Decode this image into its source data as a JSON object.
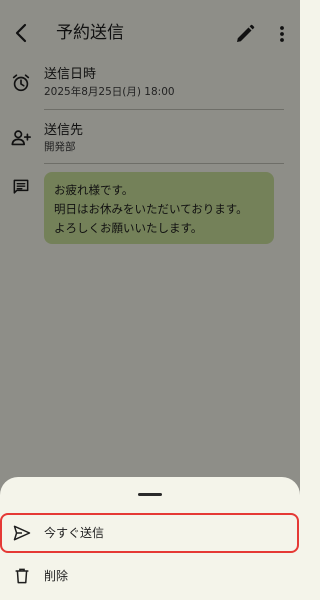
{
  "app_bar": {
    "title": "予約送信"
  },
  "details": {
    "datetime_label": "送信日時",
    "datetime_value": "2025年8月25日(月) 18:00",
    "recipient_label": "送信先",
    "recipient_value": "開発部"
  },
  "message": {
    "lines": [
      "お疲れ様です。",
      "明日はお休みをいただいております。",
      "よろしくお願いいたします。"
    ]
  },
  "sheet": {
    "items": [
      {
        "label": "今すぐ送信",
        "icon": "send-icon"
      },
      {
        "label": "削除",
        "icon": "trash-icon"
      }
    ]
  },
  "colors": {
    "bubble": "#c9de9a",
    "surface": "#f4f4ea",
    "highlight": "#e53935"
  }
}
